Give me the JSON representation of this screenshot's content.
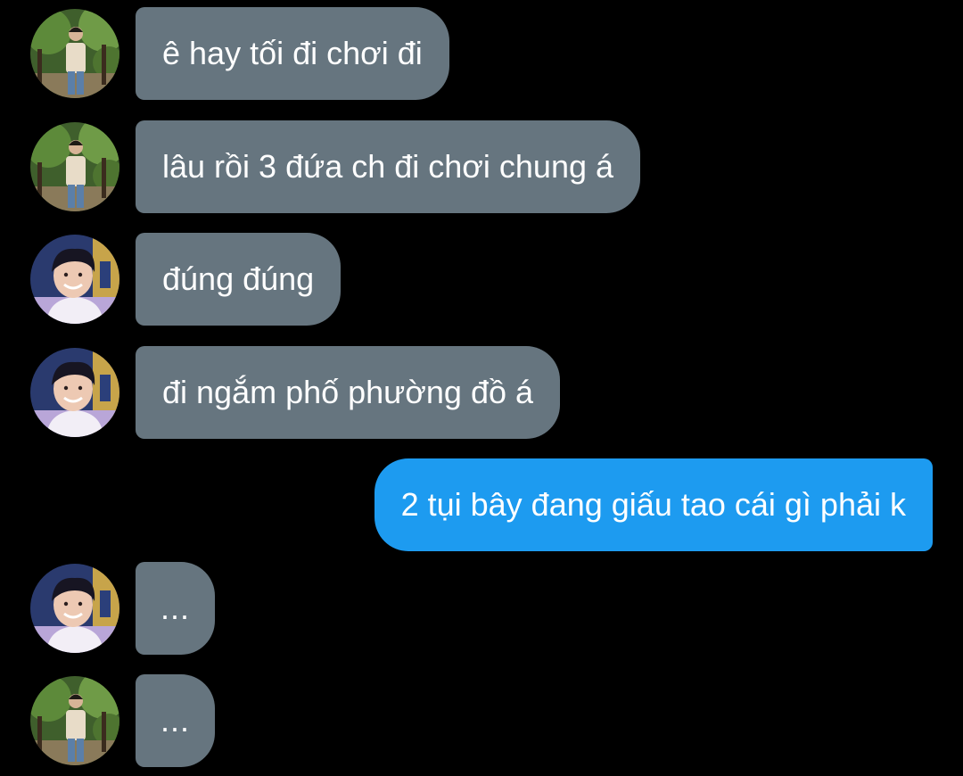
{
  "colors": {
    "background": "#000000",
    "incoming_bubble": "#66757f",
    "outgoing_bubble": "#1d9bf0",
    "text": "#ffffff"
  },
  "messages": [
    {
      "sender": "friend-a",
      "direction": "incoming",
      "text": "ê hay tối đi chơi đi"
    },
    {
      "sender": "friend-a",
      "direction": "incoming",
      "text": "lâu rồi 3 đứa ch đi chơi chung á"
    },
    {
      "sender": "friend-b",
      "direction": "incoming",
      "text": "đúng đúng"
    },
    {
      "sender": "friend-b",
      "direction": "incoming",
      "text": "đi ngắm phố phường đồ á"
    },
    {
      "sender": "me",
      "direction": "outgoing",
      "text": "2 tụi bây đang giấu tao cái gì phải k"
    },
    {
      "sender": "friend-b",
      "direction": "incoming",
      "text": "..."
    },
    {
      "sender": "friend-a",
      "direction": "incoming",
      "text": "..."
    }
  ],
  "avatars": {
    "friend-a": "avatar-photo-outdoor-park",
    "friend-b": "avatar-photo-smiling-boy"
  }
}
